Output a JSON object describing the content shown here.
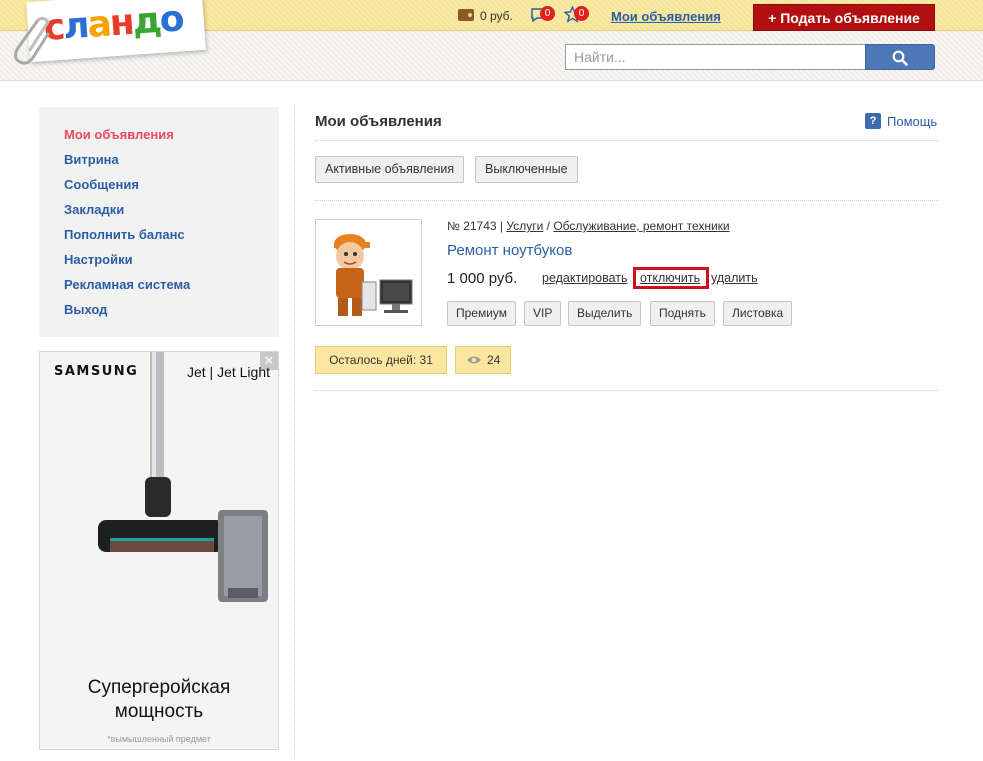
{
  "header": {
    "logo_letters": [
      "с",
      "л",
      "а",
      "н",
      "д",
      "о"
    ],
    "balance": "0 руб.",
    "messages_count": "0",
    "favorites_count": "0",
    "my_ads_link": "Мои объявления",
    "post_ad_button": "+ Подать объявление",
    "search_placeholder": "Найти..."
  },
  "sidebar": {
    "items": [
      {
        "label": "Мои объявления",
        "active": true
      },
      {
        "label": "Витрина"
      },
      {
        "label": "Сообщения"
      },
      {
        "label": "Закладки"
      },
      {
        "label": "Пополнить баланс"
      },
      {
        "label": "Настройки"
      },
      {
        "label": "Рекламная система"
      },
      {
        "label": "Выход"
      }
    ]
  },
  "ad": {
    "close": "✕",
    "brand": "SAMSUNG",
    "model": "Jet | Jet Light",
    "title_line1": "Супергеройская",
    "title_line2": "мощность",
    "note": "*вымышленный предмет"
  },
  "main": {
    "title": "Мои объявления",
    "help": "Помощь",
    "help_icon": "?",
    "tabs": [
      "Активные объявления",
      "Выключенные"
    ],
    "listing": {
      "number": "№ 21743",
      "separator": "|",
      "category": "Услуги",
      "slash": "/",
      "subcategory": "Обслуживание, ремонт техники",
      "title": "Ремонт ноутбуков",
      "price": "1 000 руб.",
      "actions": {
        "edit": "редактировать",
        "disable": "отключить",
        "delete": "удалить"
      },
      "services": [
        "Премиум",
        "VIP",
        "Выделить",
        "Поднять",
        "Листовка"
      ],
      "days_left": "Осталось дней: 31",
      "views": "24"
    }
  },
  "colors": {
    "header_top": "#f8e79c",
    "accent_red": "#b21010",
    "link_blue": "#2b5ea4",
    "active_pink": "#e84a5f",
    "highlight_red": "#d40e1b",
    "badge_yellow": "#fbe6a1"
  }
}
